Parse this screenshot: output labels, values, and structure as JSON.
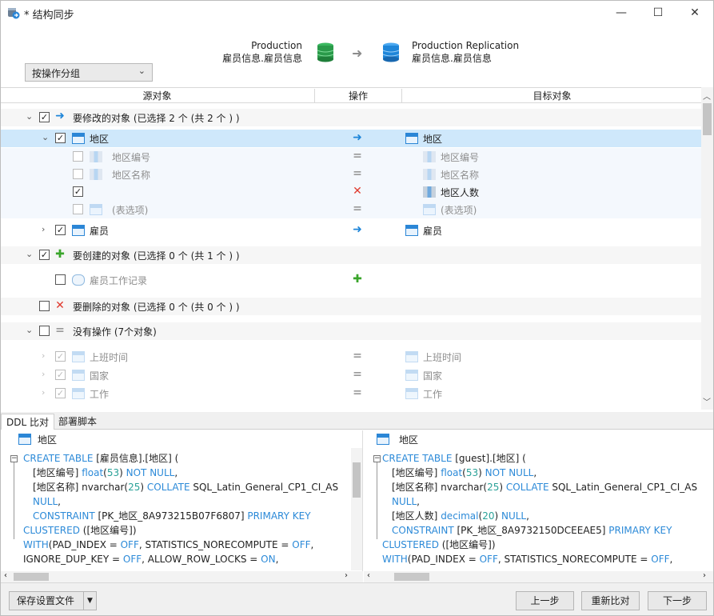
{
  "window": {
    "title": "* 结构同步",
    "min": "—",
    "max": "☐",
    "close": "✕"
  },
  "source": {
    "server": "Production",
    "schema": "雇员信息.雇员信息"
  },
  "target": {
    "server": "Production Replication",
    "schema": "雇员信息.雇员信息"
  },
  "group_select": {
    "value": "按操作分组"
  },
  "columns": {
    "source": "源对象",
    "operation": "操作",
    "target": "目标对象"
  },
  "tree": {
    "modify_group": "要修改的对象 (已选择 2 个 (共 2 个 ) )",
    "table_region": "地区",
    "region_fields": [
      {
        "src": "地区编号",
        "op": "=",
        "tgt": "地区编号",
        "checked": false
      },
      {
        "src": "地区名称",
        "op": "=",
        "tgt": "地区名称",
        "checked": false
      },
      {
        "src": "",
        "op": "✕",
        "tgt": "地区人数",
        "checked": true
      },
      {
        "src": "(表选项)",
        "op": "=",
        "tgt": "(表选项)",
        "checked": false
      }
    ],
    "table_employee": "雇员",
    "create_group": "要创建的对象 (已选择 0 个 (共 1 个 ) )",
    "create_item": "雇员工作记录",
    "delete_group": "要删除的对象 (已选择 0 个 (共 0 个 ) )",
    "noop_group": "没有操作  (7个对象)",
    "noop_items": [
      "上班时间",
      "国家",
      "工作"
    ]
  },
  "tabs": {
    "ddl": "DDL 比对",
    "deploy": "部署脚本"
  },
  "ddl_left": {
    "title": "地区",
    "lines": [
      [
        "CREATE TABLE",
        " [雇员信息].[地区] ("
      ],
      [
        "",
        "[地区编号] ",
        "float",
        "(",
        "53",
        ")  ",
        "NOT NULL",
        ","
      ],
      [
        "",
        "[地区名称] nvarchar(",
        "25",
        ")  ",
        "COLLATE",
        " SQL_Latin_General_CP1_CI_AS"
      ],
      [
        "NULL",
        ","
      ],
      [
        "CONSTRAINT",
        " [PK_地区_8A973215B07F6807]  ",
        "PRIMARY KEY"
      ],
      [
        "CLUSTERED",
        " ([地区编号])"
      ],
      [
        "WITH",
        "(PAD_INDEX = ",
        "OFF",
        ", STATISTICS_NORECOMPUTE = ",
        "OFF",
        ","
      ],
      [
        "",
        "IGNORE_DUP_KEY = ",
        "OFF",
        ", ALLOW_ROW_LOCKS = ",
        "ON",
        ","
      ]
    ]
  },
  "ddl_right": {
    "title": "地区",
    "lines": [
      [
        "CREATE TABLE",
        " [guest].[地区] ("
      ],
      [
        "",
        "[地区编号] ",
        "float",
        "(",
        "53",
        ")  ",
        "NOT NULL",
        ","
      ],
      [
        "",
        "[地区名称] nvarchar(",
        "25",
        ")  ",
        "COLLATE",
        " SQL_Latin_General_CP1_CI_AS"
      ],
      [
        "NULL",
        ","
      ],
      [
        "",
        "[地区人数] ",
        "decimal",
        "(",
        "20",
        ")  ",
        "NULL",
        ","
      ],
      [
        "CONSTRAINT",
        " [PK_地区_8A9732150DCEEAE5]  ",
        "PRIMARY KEY"
      ],
      [
        "CLUSTERED",
        " ([地区编号])"
      ],
      [
        "WITH",
        "(PAD_INDEX = ",
        "OFF",
        ", STATISTICS_NORECOMPUTE = ",
        "OFF",
        ","
      ]
    ]
  },
  "footer": {
    "save": "保存设置文件",
    "prev": "上一步",
    "recompare": "重新比对",
    "next": "下一步"
  }
}
